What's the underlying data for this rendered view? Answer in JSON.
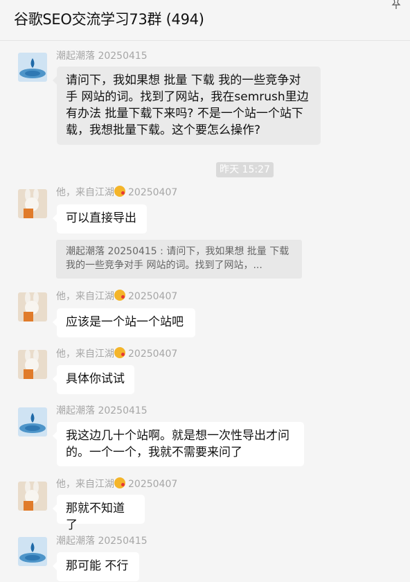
{
  "header": {
    "title": "谷歌SEO交流学习73群 (494)"
  },
  "chat": {
    "time_divider": "昨天 15:27",
    "messages": [
      {
        "sender": "潮起潮落 20250415",
        "text": "请问下，我如果想 批量 下载 我的一些竞争对手 网站的词。找到了网站，我在semrush里边有办法 批量下载下来吗? 不是一个站一个站下载，我想批量下载。这个要怎么操作?"
      },
      {
        "sender": "他，来自江湖",
        "sender_date": "20250407",
        "text": "可以直接导出"
      },
      {
        "quote": "潮起潮落 20250415 : 请问下，我如果想 批量 下载 我的一些竞争对手 网站的词。找到了网站，..."
      },
      {
        "sender": "他，来自江湖",
        "sender_date": "20250407",
        "text": "应该是一个站一个站吧"
      },
      {
        "sender": "他，来自江湖",
        "sender_date": "20250407",
        "text": "具体你试试"
      },
      {
        "sender": "潮起潮落 20250415",
        "text": "我这边几十个站啊。就是想一次性导出才问的。一个一个，我就不需要来问了"
      },
      {
        "sender": "他，来自江湖",
        "sender_date": "20250407",
        "text": "那就不知道了"
      },
      {
        "sender": "潮起潮落 20250415",
        "text": "那可能 不行"
      }
    ]
  }
}
